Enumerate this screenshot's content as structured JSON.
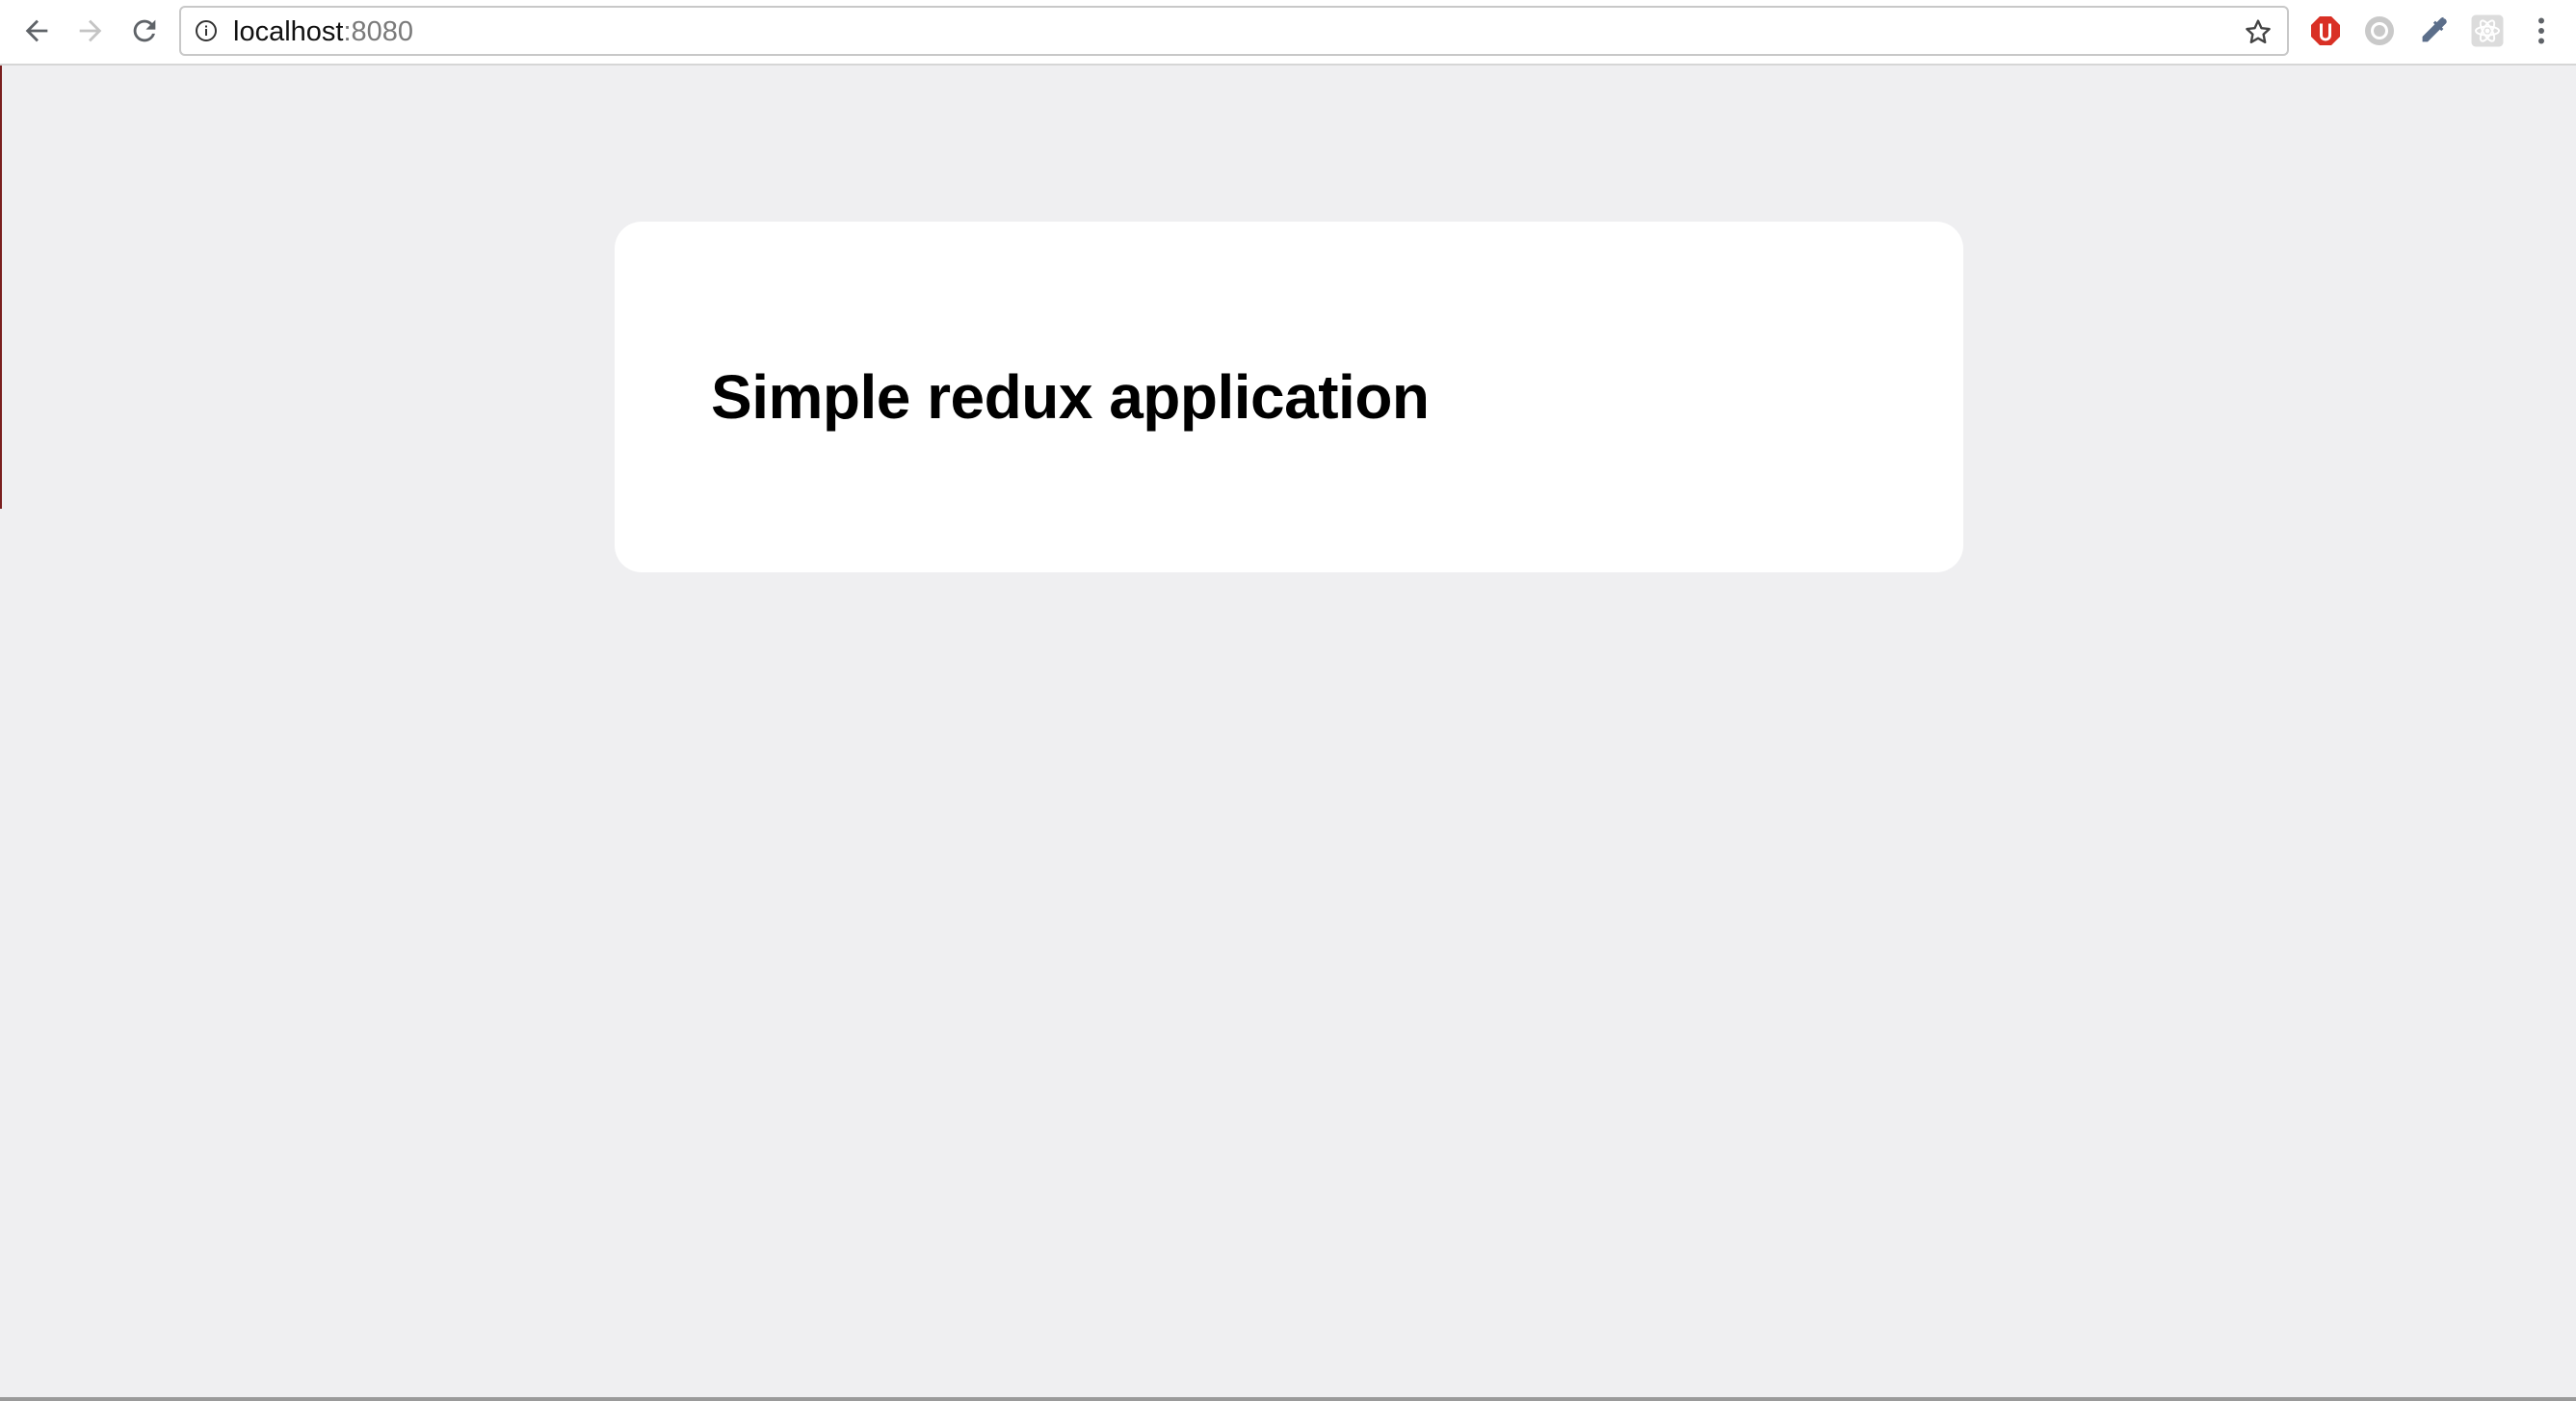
{
  "browser": {
    "url_host": "localhost",
    "url_port": ":8080",
    "icons": {
      "back": "back-arrow-icon",
      "forward": "forward-arrow-icon",
      "reload": "reload-icon",
      "info": "info-icon",
      "bookmark": "star-icon",
      "menu": "kebab-menu-icon"
    },
    "extensions": [
      "adblock-icon",
      "grey-circle-extension-icon",
      "eyedropper-icon",
      "react-devtools-icon"
    ]
  },
  "page": {
    "title": "Simple redux application"
  },
  "colors": {
    "page_background": "#efeff1",
    "card_background": "#ffffff",
    "title_text": "#000000"
  }
}
